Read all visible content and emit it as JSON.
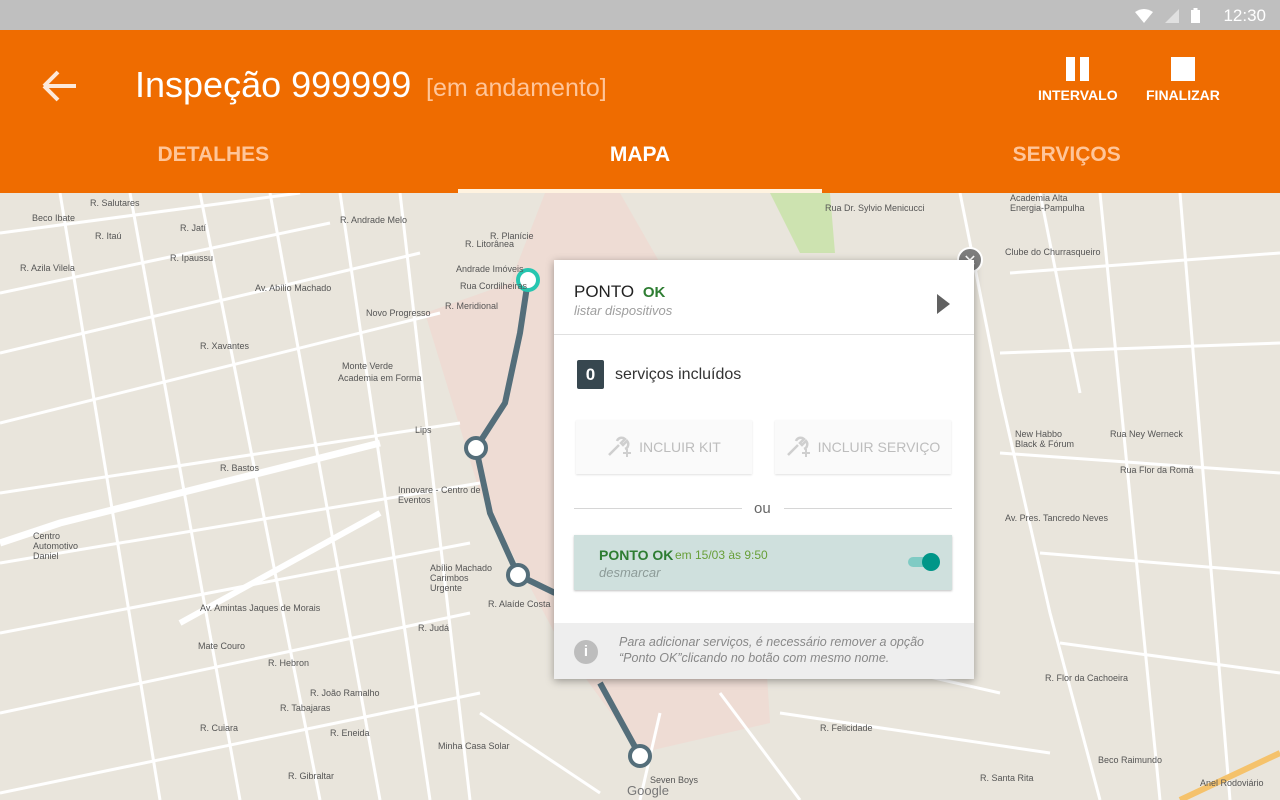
{
  "status": {
    "time": "12:30"
  },
  "header": {
    "title": "Inspeção 999999",
    "subtitle": "[em andamento]",
    "actions": {
      "pause": "INTERVALO",
      "finish": "FINALIZAR"
    }
  },
  "tabs": [
    {
      "label": "DETALHES",
      "active": false
    },
    {
      "label": "MAPA",
      "active": true
    },
    {
      "label": "SERVIÇOS",
      "active": false
    }
  ],
  "colors": {
    "primary": "#ef6c00",
    "accent": "#009688",
    "route": "#546e7a"
  },
  "map": {
    "labels": [
      "R. Salutares",
      "Beco Ibate",
      "R. Itaú",
      "R. Jatí",
      "R. Ipaussu",
      "R. Azila Vilela",
      "Av. Abílio Machado",
      "R. Andrade Melo",
      "R. Litorânea",
      "R. Planície",
      "Andrade Imóveis",
      "Rua Cordilheiras",
      "R. Meridional",
      "Novo Progresso",
      "Monte Verde",
      "Academia em Forma",
      "R. Xavantes",
      "R. Bastos",
      "Innovare - Centro de Eventos",
      "Centro Automotivo Daniel",
      "Av. Amintas Jaques de Morais",
      "Abílio Machado Carimbos Urgente",
      "R. Alaíde Costa",
      "Mate Couro",
      "Minha Casa Solar",
      "Seven Boys",
      "Google",
      "Academia Alta Energia-Pampulha",
      "Clube do Churrasqueiro",
      "New Habbo Black & Fórum",
      "Rua Ney Werneck",
      "Rua Flor da Romã",
      "Rua Dr. Sylvio Menicucci",
      "Av. Pres. Tancredo Neves",
      "R. Flor da Cachoeira",
      "Beco Raimundo",
      "R. Santa Rita",
      "Anel Rodoviário",
      "Lips",
      "R. Tabajaras",
      "R. Hebron",
      "R. Judá",
      "R. Cuiara",
      "R. João Ramalho",
      "R. Gibraltar",
      "R. Eneida",
      "R. Felicidade"
    ]
  },
  "card": {
    "ponto_label": "PONTO",
    "ponto_status": "OK",
    "sub": "listar dispositivos",
    "services_count": "0",
    "services_text": "serviços incluídos",
    "btn_kit": "INCLUIR KIT",
    "btn_service": "INCLUIR SERVIÇO",
    "or": "ou",
    "ok_title": "PONTO OK",
    "ok_date": "em 15/03 às 9:50",
    "ok_unmark": "desmarcar",
    "info": "Para adicionar serviços, é necessário remover a opção “Ponto OK”clicando no botão com mesmo nome."
  }
}
